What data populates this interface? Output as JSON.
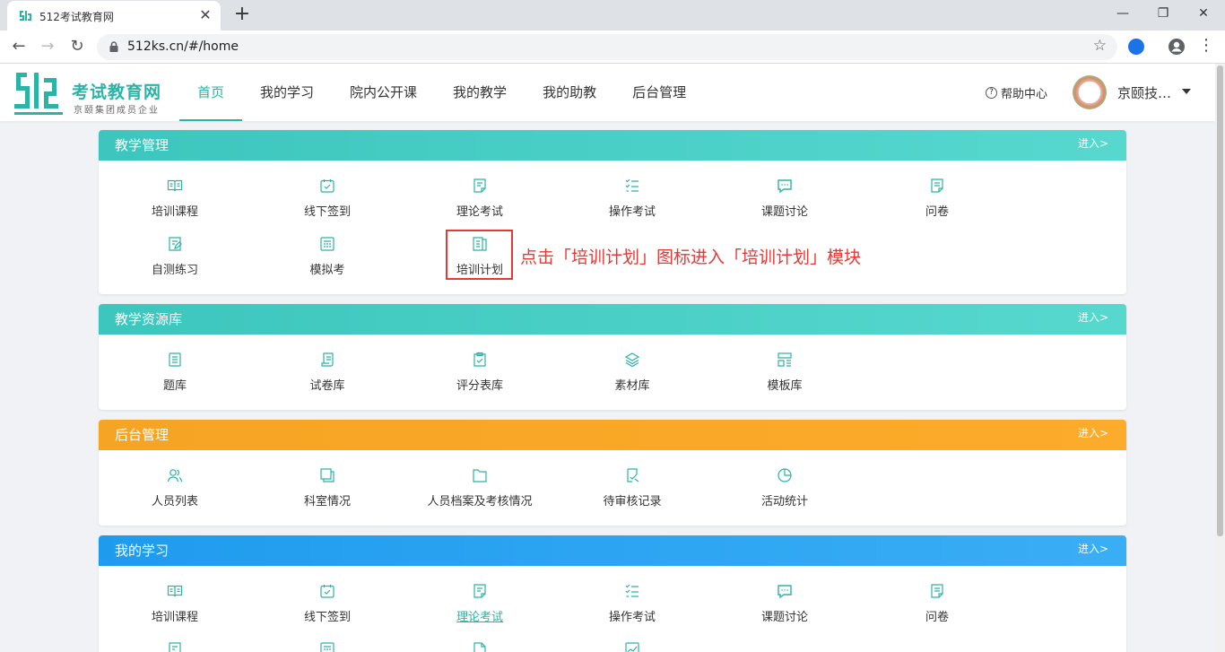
{
  "browser": {
    "tab_title": "512考试教育网",
    "url": "512ks.cn/#/home"
  },
  "header": {
    "logo_title": "考试教育网",
    "logo_subtitle": "京颐集团成员企业",
    "nav": [
      "首页",
      "我的学习",
      "院内公开课",
      "我的教学",
      "我的助教",
      "后台管理"
    ],
    "active_nav": "首页",
    "help": "帮助中心",
    "user": "京颐技…"
  },
  "panels": [
    {
      "title": "教学管理",
      "enter": "进入>",
      "items": [
        {
          "label": "培训课程",
          "icon": "book-icon"
        },
        {
          "label": "线下签到",
          "icon": "calendar-check-icon"
        },
        {
          "label": "理论考试",
          "icon": "document-edit-icon"
        },
        {
          "label": "操作考试",
          "icon": "checklist-icon"
        },
        {
          "label": "课题讨论",
          "icon": "chat-icon"
        },
        {
          "label": "问卷",
          "icon": "questionnaire-icon"
        },
        {
          "label": "自测练习",
          "icon": "practice-icon"
        },
        {
          "label": "模拟考",
          "icon": "mock-exam-icon"
        },
        {
          "label": "培训计划",
          "icon": "plan-icon"
        }
      ]
    },
    {
      "title": "教学资源库",
      "enter": "进入>",
      "items": [
        {
          "label": "题库",
          "icon": "list-doc-icon"
        },
        {
          "label": "试卷库",
          "icon": "paper-icon"
        },
        {
          "label": "评分表库",
          "icon": "clipboard-check-icon"
        },
        {
          "label": "素材库",
          "icon": "layers-icon"
        },
        {
          "label": "模板库",
          "icon": "template-icon"
        }
      ]
    },
    {
      "title": "后台管理",
      "enter": "进入>",
      "items": [
        {
          "label": "人员列表",
          "icon": "users-icon"
        },
        {
          "label": "科室情况",
          "icon": "department-icon"
        },
        {
          "label": "人员档案及考核情况",
          "icon": "folder-icon"
        },
        {
          "label": "待审核记录",
          "icon": "review-icon"
        },
        {
          "label": "活动统计",
          "icon": "pie-chart-icon"
        }
      ]
    },
    {
      "title": "我的学习",
      "enter": "进入>",
      "items": [
        {
          "label": "培训课程",
          "icon": "book-icon"
        },
        {
          "label": "线下签到",
          "icon": "calendar-check-icon"
        },
        {
          "label": "理论考试",
          "icon": "document-edit-icon"
        },
        {
          "label": "操作考试",
          "icon": "checklist-icon"
        },
        {
          "label": "课题讨论",
          "icon": "chat-icon"
        },
        {
          "label": "问卷",
          "icon": "questionnaire-icon"
        }
      ]
    }
  ],
  "annotation": "点击「培训计划」图标进入「培训计划」模块",
  "colors": {
    "accent": "#2bb3a6",
    "teal_header": "#3cc6bd",
    "orange_header": "#f5a423",
    "blue_header": "#1f9bee",
    "annotation_red": "#e53935"
  }
}
